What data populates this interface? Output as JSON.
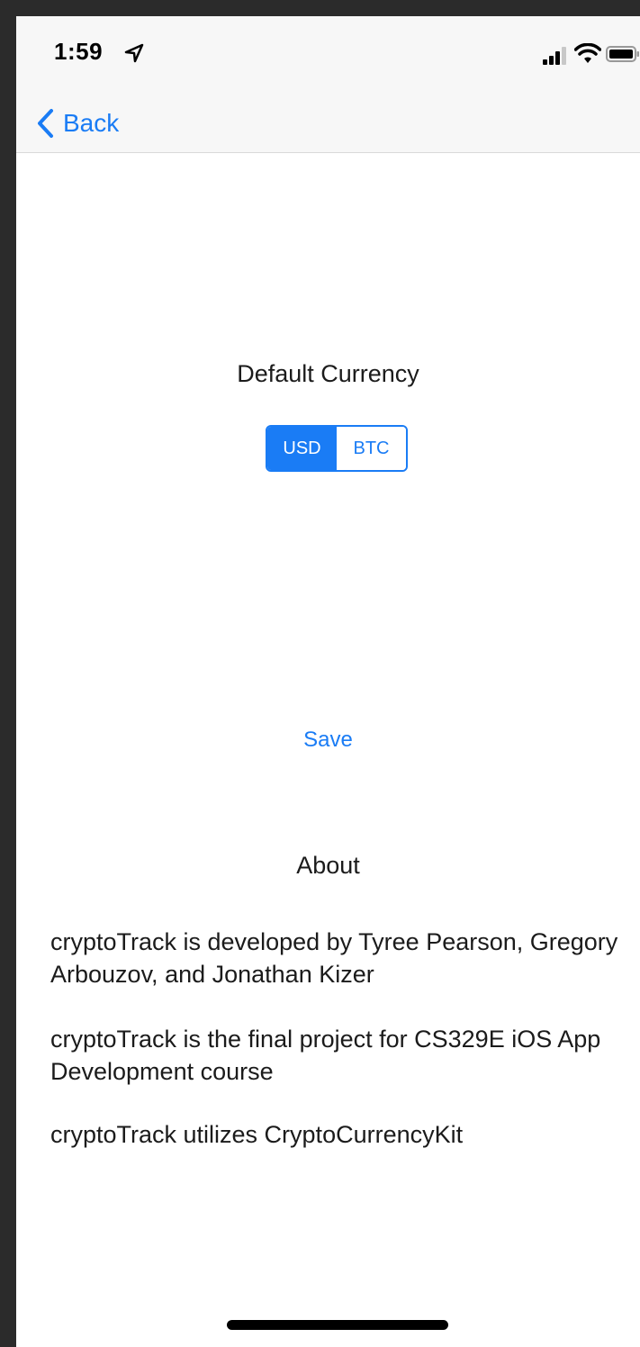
{
  "status_bar": {
    "time": "1:59",
    "icons": [
      "location-arrow-icon",
      "cellular-signal-icon",
      "wifi-icon",
      "battery-icon"
    ]
  },
  "nav": {
    "back_label": "Back"
  },
  "settings": {
    "currency_title": "Default Currency",
    "segments": [
      {
        "label": "USD",
        "selected": true
      },
      {
        "label": "BTC",
        "selected": false
      }
    ],
    "save_label": "Save"
  },
  "about": {
    "title": "About",
    "paragraphs": [
      "cryptoTrack is developed by Tyree Pearson, Gregory Arbouzov, and Jonathan Kizer",
      "cryptoTrack is the final project for CS329E iOS App Development course",
      "cryptoTrack utilizes CryptoCurrencyKit"
    ]
  },
  "colors": {
    "accent": "#1a7cf5",
    "bar_background": "#f7f7f7",
    "outer_background": "#2b2b2b"
  }
}
